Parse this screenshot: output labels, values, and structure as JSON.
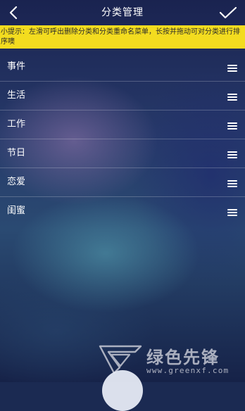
{
  "header": {
    "title": "分类管理",
    "back_icon": "chevron-left-icon",
    "confirm_icon": "checkmark-icon"
  },
  "tip": {
    "text": "小提示：左滑可呼出删除分类和分类重命名菜单，长按并拖动可对分类进行排序噢",
    "background_color": "#f3dc1f"
  },
  "categories": [
    {
      "label": "事件"
    },
    {
      "label": "生活"
    },
    {
      "label": "工作"
    },
    {
      "label": "节日"
    },
    {
      "label": "恋爱"
    },
    {
      "label": "闺蜜"
    }
  ],
  "row_handle_icon": "drag-handle-icon",
  "watermark": {
    "brand": "绿色先锋",
    "url": "www.greenxf.com"
  }
}
